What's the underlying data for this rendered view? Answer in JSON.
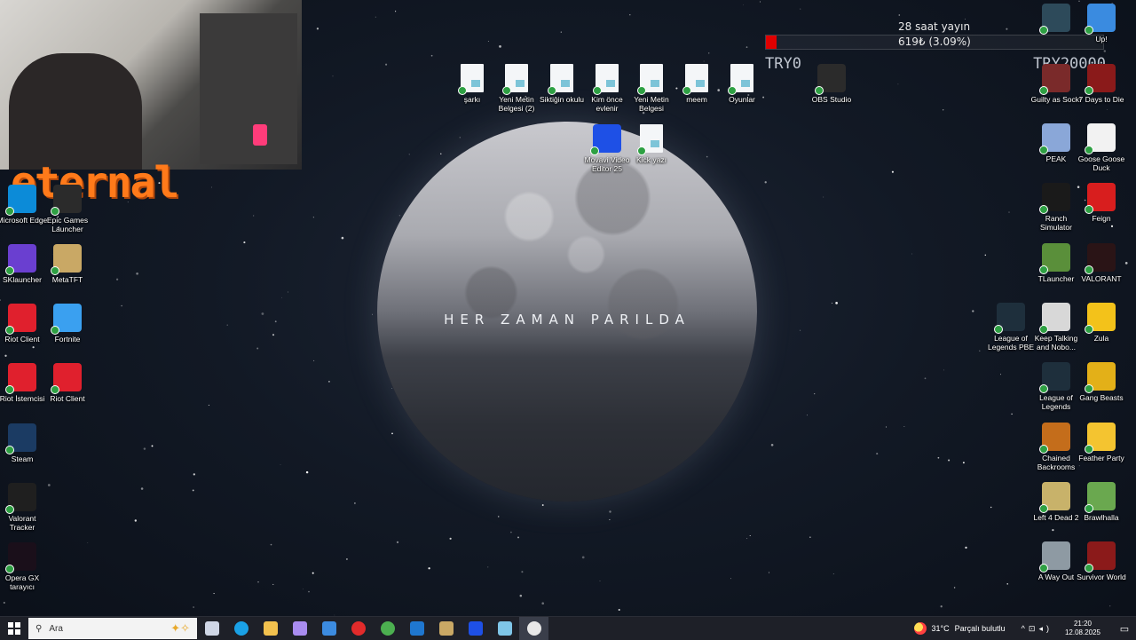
{
  "wallpaper": {
    "text": "HER ZAMAN PARILDA"
  },
  "overlay": {
    "brand": "eternal",
    "goal_title": "28 saat yayın",
    "goal_progress_text": "619₺ (3.09%)",
    "goal_progress_percent": 3.09,
    "goal_min_label": "TRY0",
    "goal_max_label": "TRY20000"
  },
  "desktop_left": [
    {
      "label": "Microsoft Edge",
      "icon": "edge-icon",
      "color": "#0c8bd8"
    },
    {
      "label": "Epic Games Launcher",
      "icon": "epic-games-icon",
      "color": "#2b2b2b"
    },
    {
      "label": "SKlauncher",
      "icon": "sklauncher-icon",
      "color": "#6a3fd0"
    },
    {
      "label": "MetaTFT",
      "icon": "metatft-icon",
      "color": "#c9a865"
    },
    {
      "label": "Riot Client",
      "icon": "riot-client-icon",
      "color": "#e0202d"
    },
    {
      "label": "Fortnite",
      "icon": "fortnite-icon",
      "color": "#3aa0f0"
    },
    {
      "label": "Riot İstemcisi",
      "icon": "riot-client-icon",
      "color": "#e0202d"
    },
    {
      "label": "Riot Client",
      "icon": "riot-client-icon",
      "color": "#e0202d"
    },
    {
      "label": "Steam",
      "icon": "steam-icon",
      "color": "#1b3b63"
    },
    {
      "label": "Valorant Tracker",
      "icon": "valorant-tracker-icon",
      "color": "#1f1f1f"
    },
    {
      "label": "Opera GX tarayıcı",
      "icon": "opera-gx-icon",
      "color": "#1a0f1a"
    }
  ],
  "desktop_center": [
    {
      "label": "şarkı",
      "icon": "document-icon"
    },
    {
      "label": "Yeni Metin Belgesi (2)",
      "icon": "document-icon"
    },
    {
      "label": "Siktiğin okulu",
      "icon": "document-icon"
    },
    {
      "label": "Kim önce evlenir",
      "icon": "document-icon"
    },
    {
      "label": "Yeni Metin Belgesi",
      "icon": "document-icon"
    },
    {
      "label": "meem",
      "icon": "document-icon"
    },
    {
      "label": "Oyunlar",
      "icon": "document-icon"
    },
    {
      "label": "OBS Studio",
      "icon": "obs-icon"
    },
    {
      "label": "Movavi Video Editor 25",
      "icon": "movavi-icon"
    },
    {
      "label": "Kick yazı",
      "icon": "document-icon"
    }
  ],
  "desktop_right": [
    {
      "label": "Guilty as Sock!",
      "icon": "guilty-as-sock-icon",
      "color": "#7a2a2a"
    },
    {
      "label": "7 Days to Die",
      "icon": "seven-days-icon",
      "color": "#8a1a1a"
    },
    {
      "label": "PEAK",
      "icon": "peak-icon",
      "color": "#8aa7d8"
    },
    {
      "label": "Goose Goose Duck",
      "icon": "goose-icon",
      "color": "#f2f2f2"
    },
    {
      "label": "Ranch Simulator",
      "icon": "ranch-icon",
      "color": "#1a1a1a"
    },
    {
      "label": "Feign",
      "icon": "feign-icon",
      "color": "#d81e1e"
    },
    {
      "label": "TLauncher",
      "icon": "tlauncher-icon",
      "color": "#5a8f3a"
    },
    {
      "label": "VALORANT",
      "icon": "valorant-icon",
      "color": "#2a1416"
    },
    {
      "label": "League of Legends PBE",
      "icon": "lol-pbe-icon",
      "color": "#1e2f3c"
    },
    {
      "label": "Keep Talking and Nobo...",
      "icon": "keep-talking-icon",
      "color": "#d8d8d8"
    },
    {
      "label": "Zula",
      "icon": "zula-icon",
      "color": "#f3c21a"
    },
    {
      "label": "League of Legends",
      "icon": "lol-icon",
      "color": "#1e2f3c"
    },
    {
      "label": "Gang Beasts",
      "icon": "gang-beasts-icon",
      "color": "#e3b018"
    },
    {
      "label": "Chained Backrooms",
      "icon": "chained-backrooms-icon",
      "color": "#c46d1b"
    },
    {
      "label": "Feather Party",
      "icon": "feather-party-icon",
      "color": "#f4c430"
    },
    {
      "label": "Left 4 Dead 2",
      "icon": "left4dead-icon",
      "color": "#c8b26a"
    },
    {
      "label": "Brawlhalla",
      "icon": "brawlhalla-icon",
      "color": "#6aa84f"
    },
    {
      "label": "A Way Out",
      "icon": "a-way-out-icon",
      "color": "#8e9aa3"
    },
    {
      "label": "Survivor World",
      "icon": "survivor-world-icon",
      "color": "#8b1a1a"
    }
  ],
  "desktop_top_right": [
    {
      "label": "",
      "icon": "game-icon-w",
      "color": "#2d4a5a"
    },
    {
      "label": "Up!",
      "icon": "game-icon-p",
      "color": "#3a8be0"
    }
  ],
  "taskbar": {
    "search_placeholder": "Ara",
    "apps": [
      {
        "name": "task-view",
        "color": "#cfd6e6"
      },
      {
        "name": "edge",
        "color": "#1aa1e6"
      },
      {
        "name": "file-explorer",
        "color": "#f2c14e"
      },
      {
        "name": "copilot",
        "color": "#a98cf0"
      },
      {
        "name": "store",
        "color": "#3c8be0"
      },
      {
        "name": "opera",
        "color": "#e22b2b"
      },
      {
        "name": "chrome",
        "color": "#4caf50"
      },
      {
        "name": "outlook",
        "color": "#1f77d0"
      },
      {
        "name": "metatft",
        "color": "#c9a865"
      },
      {
        "name": "movavi",
        "color": "#1e50e6"
      },
      {
        "name": "notepad",
        "color": "#7fc6e8"
      },
      {
        "name": "obs",
        "color": "#e8e8e8"
      }
    ],
    "weather_temp": "31°C",
    "weather_text": "Parçalı bulutlu",
    "time": "21:20",
    "date": "12.08.2025"
  }
}
